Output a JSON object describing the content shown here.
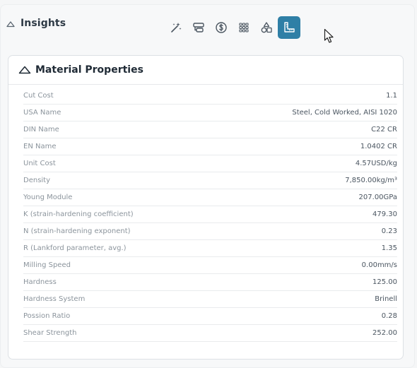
{
  "insights": {
    "title": "Insights",
    "toolbar": [
      {
        "icon": "magic-wand-icon"
      },
      {
        "icon": "layers-icon"
      },
      {
        "icon": "dollar-icon"
      },
      {
        "icon": "grid-icon"
      },
      {
        "icon": "shapes-icon"
      },
      {
        "icon": "ruler-angle-icon",
        "active": true
      }
    ]
  },
  "card": {
    "title": "Material Properties",
    "rows": [
      {
        "label": "Cut Cost",
        "value": "1.1"
      },
      {
        "label": "USA Name",
        "value": "Steel, Cold Worked, AISI 1020"
      },
      {
        "label": "DIN Name",
        "value": "C22 CR"
      },
      {
        "label": "EN Name",
        "value": "1.0402 CR"
      },
      {
        "label": "Unit Cost",
        "value": "4.57USD/kg"
      },
      {
        "label": "Density",
        "value": "7,850.00kg/m³"
      },
      {
        "label": "Young Module",
        "value": "207.00GPa"
      },
      {
        "label": "K (strain-hardening coefficient)",
        "value": "479.30"
      },
      {
        "label": "N (strain-hardening exponent)",
        "value": "0.23"
      },
      {
        "label": "R (Lankford parameter, avg.)",
        "value": "1.35"
      },
      {
        "label": "Milling Speed",
        "value": "0.00mm/s"
      },
      {
        "label": "Hardness",
        "value": "125.00"
      },
      {
        "label": "Hardness System",
        "value": "Brinell"
      },
      {
        "label": "Possion Ratio",
        "value": "0.28"
      },
      {
        "label": "Shear Strength",
        "value": "252.00"
      }
    ]
  },
  "colors": {
    "accent": "#2f7fa6",
    "background": "#f5f6f7",
    "card": "#ffffff"
  }
}
